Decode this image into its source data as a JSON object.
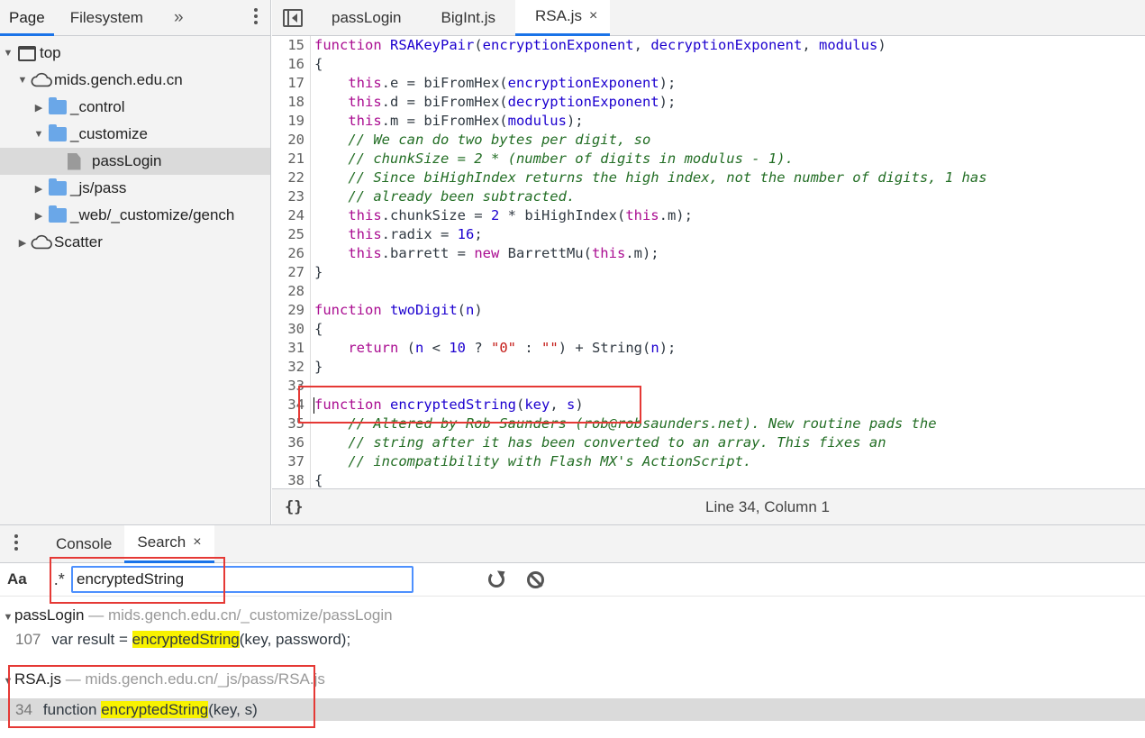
{
  "navigator": {
    "tabs": [
      "Page",
      "Filesystem"
    ],
    "more": "»",
    "tree": [
      {
        "label": "top",
        "icon": "frame-icon"
      },
      {
        "label": "mids.gench.edu.cn",
        "icon": "cloud-icon"
      },
      {
        "label": "_control",
        "icon": "folder-icon"
      },
      {
        "label": "_customize",
        "icon": "folder-icon"
      },
      {
        "label": "passLogin",
        "icon": "file-icon"
      },
      {
        "label": "_js/pass",
        "icon": "folder-icon"
      },
      {
        "label": "_web/_customize/gench",
        "icon": "folder-icon"
      },
      {
        "label": "Scatter",
        "icon": "cloud-icon"
      }
    ]
  },
  "editor": {
    "tabs": [
      "passLogin",
      "BigInt.js",
      "RSA.js"
    ],
    "active_tab": "RSA.js",
    "close": "×",
    "line_numbers": [
      "15",
      "16",
      "17",
      "18",
      "19",
      "20",
      "21",
      "22",
      "23",
      "24",
      "25",
      "26",
      "27",
      "28",
      "29",
      "30",
      "31",
      "32",
      "33",
      "34",
      "35",
      "36",
      "37",
      "38"
    ],
    "status_format": "{}",
    "cursor_position": "Line 34, Column 1"
  },
  "drawer": {
    "tabs": [
      "Console",
      "Search"
    ],
    "close": "×",
    "match_case": "Aa",
    "regex": ".*",
    "query": "encryptedString",
    "results": [
      {
        "file": "passLogin",
        "path": " — mids.gench.edu.cn/_customize/passLogin",
        "line": "107",
        "before": "var result = ",
        "match": "encryptedString",
        "after": "(key, password);"
      },
      {
        "file": "RSA.js",
        "path": " — mids.gench.edu.cn/_js/pass/RSA.js",
        "line": "34",
        "before": "function ",
        "match": "encryptedString",
        "after": "(key, s)"
      }
    ]
  },
  "colors": {
    "accent": "#1a73e8",
    "highlight": "#f8f200",
    "annotation": "#e53935",
    "keyword": "#aa0d91",
    "comment": "#236e25"
  }
}
